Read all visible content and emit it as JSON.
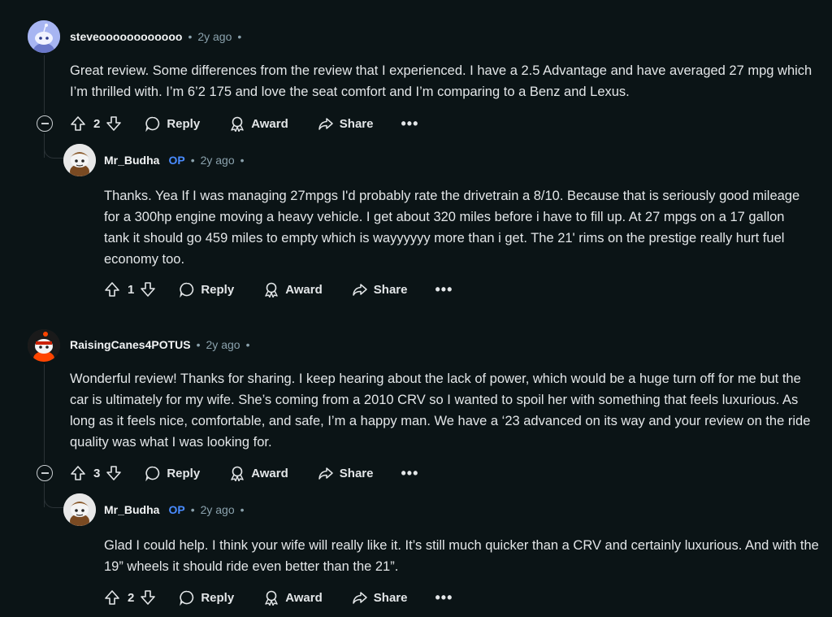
{
  "comments": [
    {
      "username": "steveoooooooooooo",
      "time": "2y ago",
      "sep": "•",
      "body": "Great review. Some differences from the review that I experienced. I have a 2.5 Advantage and have averaged 27 mpg which I’m thrilled with. I’m 6’2 175 and love the seat comfort and I’m comparing to a Benz and Lexus.",
      "votes": "2"
    },
    {
      "username": "Mr_Budha",
      "flair": "OP",
      "time": "2y ago",
      "sep": "•",
      "body": "Thanks. Yea If I was managing 27mpgs I'd probably rate the drivetrain a 8/10. Because that is seriously good mileage for a 300hp engine moving a heavy vehicle. I get about 320 miles before i have to fill up. At 27 mpgs on a 17 gallon tank it should go 459 miles to empty which is wayyyyyy more than i get. The 21' rims on the prestige really hurt fuel economy too.",
      "votes": "1"
    },
    {
      "username": "RaisingCanes4POTUS",
      "time": "2y ago",
      "sep": "•",
      "body": "Wonderful review! Thanks for sharing. I keep hearing about the lack of power, which would be a huge turn off for me but the car is ultimately for my wife. She’s coming from a 2010 CRV so I wanted to spoil her with something that feels luxurious. As long as it feels nice, comfortable, and safe, I’m a happy man. We have a ‘23 advanced on its way and your review on the ride quality was what I was looking for.",
      "votes": "3"
    },
    {
      "username": "Mr_Budha",
      "flair": "OP",
      "time": "2y ago",
      "sep": "•",
      "body": "Glad I could help. I think your wife will really like it. It’s still much quicker than a CRV and certainly luxurious. And with the 19” wheels it should ride even better than the 21”.",
      "votes": "2"
    }
  ],
  "actions": {
    "reply": "Reply",
    "award": "Award",
    "share": "Share",
    "more": "•••",
    "dot": "•"
  },
  "colors": {
    "background": "#0b1416",
    "op": "#4a8cff",
    "meta": "#8ba2ad"
  }
}
